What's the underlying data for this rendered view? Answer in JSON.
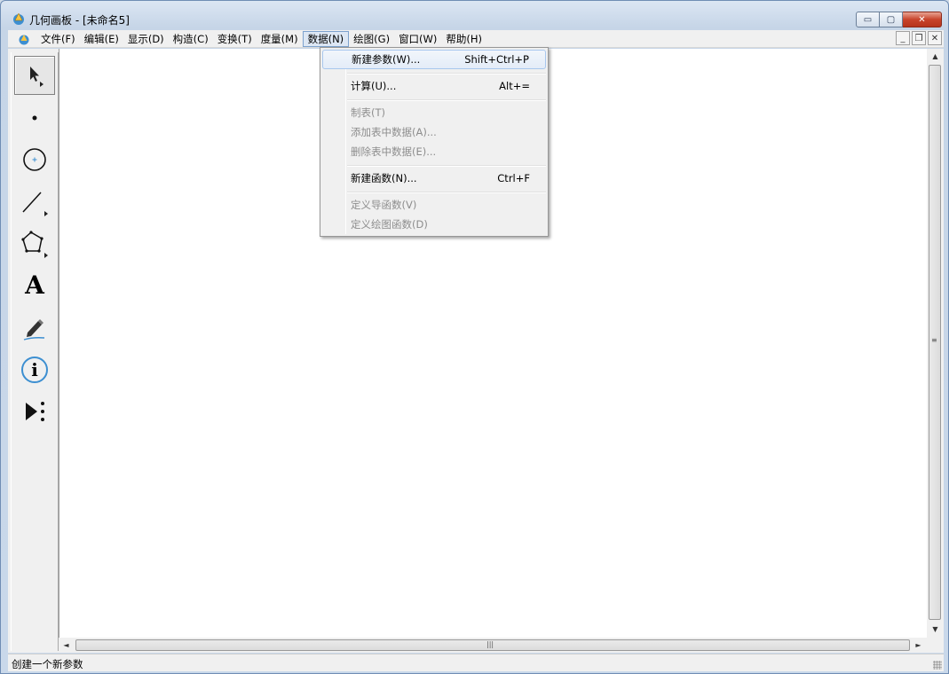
{
  "window": {
    "title": "几何画板 - [未命名5]",
    "min_glyph": "▭",
    "max_glyph": "▢",
    "close_glyph": "✕"
  },
  "menubar": {
    "items": [
      {
        "label": "文件(F)"
      },
      {
        "label": "编辑(E)"
      },
      {
        "label": "显示(D)"
      },
      {
        "label": "构造(C)"
      },
      {
        "label": "变换(T)"
      },
      {
        "label": "度量(M)"
      },
      {
        "label": "数据(N)",
        "active": true
      },
      {
        "label": "绘图(G)"
      },
      {
        "label": "窗口(W)"
      },
      {
        "label": "帮助(H)"
      }
    ],
    "mdi": {
      "min": "_",
      "restore": "❐",
      "close": "✕"
    }
  },
  "data_menu": {
    "items": [
      {
        "label": "新建参数(W)...",
        "shortcut": "Shift+Ctrl+P",
        "enabled": true,
        "highlighted": true
      },
      {
        "label": "计算(U)...",
        "shortcut": "Alt+=",
        "enabled": true
      },
      {
        "label": "制表(T)",
        "enabled": false
      },
      {
        "label": "添加表中数据(A)...",
        "enabled": false
      },
      {
        "label": "删除表中数据(E)...",
        "enabled": false
      },
      {
        "label": "新建函数(N)...",
        "shortcut": "Ctrl+F",
        "enabled": true
      },
      {
        "label": "定义导函数(V)",
        "enabled": false
      },
      {
        "label": "定义绘图函数(D)",
        "enabled": false
      }
    ]
  },
  "toolbox": {
    "tools": [
      {
        "icon": "arrow-select-icon",
        "selected": true
      },
      {
        "icon": "point-icon"
      },
      {
        "icon": "compass-circle-icon"
      },
      {
        "icon": "straightedge-icon"
      },
      {
        "icon": "polygon-icon"
      },
      {
        "icon": "text-icon",
        "glyph": "A"
      },
      {
        "icon": "marker-pen-icon"
      },
      {
        "icon": "information-icon",
        "glyph": "i"
      },
      {
        "icon": "custom-tool-icon"
      }
    ]
  },
  "scrollbars": {
    "up": "▲",
    "down": "▼",
    "left": "◄",
    "right": "►",
    "grip_v": "≡",
    "grip_h": "|||"
  },
  "status": {
    "text": "创建一个新参数"
  },
  "colors": {
    "accent": "#3d8fd1",
    "highlight_border": "#a8c7ee",
    "disabled_text": "#8d8d8d"
  }
}
